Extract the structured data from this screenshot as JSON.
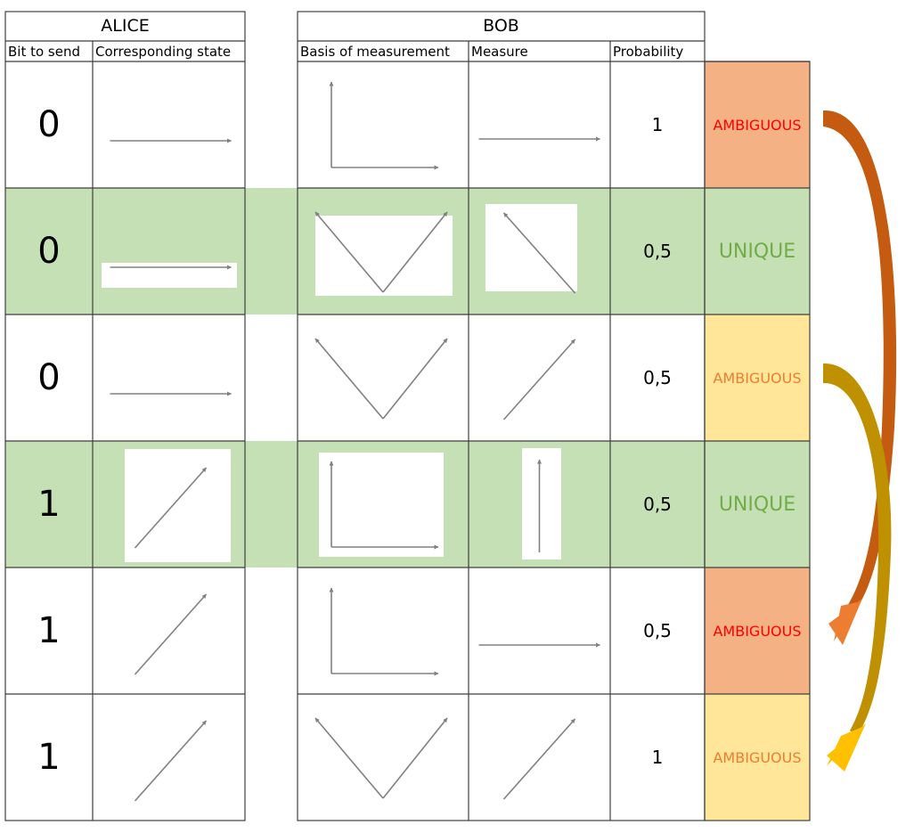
{
  "alice": {
    "title": "ALICE",
    "col_bit": "Bit to send",
    "col_state": "Corresponding state"
  },
  "bob": {
    "title": "BOB",
    "col_basis": "Basis of measurement",
    "col_measure": "Measure",
    "col_probability": "Probability"
  },
  "rows": [
    {
      "bit": "0",
      "state": "horizontal-arrow",
      "basis": "rectilinear-basis",
      "measure": "horizontal-arrow",
      "probability": "1",
      "status": "AMBIGUOUS",
      "highlight": false,
      "status_bg": "#f4b183",
      "status_color": "#ff0000"
    },
    {
      "bit": "0",
      "state": "horizontal-arrow",
      "basis": "diagonal-basis",
      "measure": "antidiagonal-arrow",
      "probability": "0,5",
      "status": "UNIQUE",
      "highlight": true,
      "status_bg": "#c5e0b4",
      "status_color": "#70ad47"
    },
    {
      "bit": "0",
      "state": "horizontal-arrow",
      "basis": "diagonal-basis",
      "measure": "diagonal-arrow",
      "probability": "0,5",
      "status": "AMBIGUOUS",
      "highlight": false,
      "status_bg": "#ffe699",
      "status_color": "#ed7d31"
    },
    {
      "bit": "1",
      "state": "diagonal-arrow",
      "basis": "rectilinear-basis",
      "measure": "vertical-arrow",
      "probability": "0,5",
      "status": "UNIQUE",
      "highlight": true,
      "status_bg": "#c5e0b4",
      "status_color": "#70ad47"
    },
    {
      "bit": "1",
      "state": "diagonal-arrow",
      "basis": "rectilinear-basis",
      "measure": "horizontal-arrow",
      "probability": "0,5",
      "status": "AMBIGUOUS",
      "highlight": false,
      "status_bg": "#f4b183",
      "status_color": "#ff0000"
    },
    {
      "bit": "1",
      "state": "diagonal-arrow",
      "basis": "diagonal-basis",
      "measure": "diagonal-arrow",
      "probability": "1",
      "status": "AMBIGUOUS",
      "highlight": false,
      "status_bg": "#ffe699",
      "status_color": "#ed7d31"
    }
  ],
  "colors": {
    "highlight_green": "#c5e0b4",
    "grid_line": "#3f3f3f",
    "vector": "#808080",
    "curve_brown": "#c55a11",
    "curve_orange": "#ed7d31",
    "curve_gold": "#bf9000",
    "curve_yellow": "#ffc000"
  }
}
